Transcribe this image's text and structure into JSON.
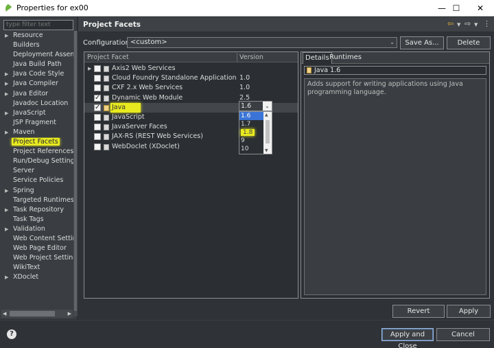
{
  "window": {
    "title": "Properties for ex00",
    "minimize": "—",
    "maximize": "☐",
    "close": "✕"
  },
  "sidebar": {
    "filter_placeholder": "type filter text",
    "items": [
      {
        "label": "Resource",
        "expandable": true
      },
      {
        "label": "Builders",
        "expandable": false
      },
      {
        "label": "Deployment Assembly",
        "expandable": false
      },
      {
        "label": "Java Build Path",
        "expandable": false
      },
      {
        "label": "Java Code Style",
        "expandable": true
      },
      {
        "label": "Java Compiler",
        "expandable": true
      },
      {
        "label": "Java Editor",
        "expandable": true
      },
      {
        "label": "Javadoc Location",
        "expandable": false
      },
      {
        "label": "JavaScript",
        "expandable": true
      },
      {
        "label": "JSP Fragment",
        "expandable": false
      },
      {
        "label": "Maven",
        "expandable": true
      },
      {
        "label": "Project Facets",
        "expandable": false,
        "selected": true
      },
      {
        "label": "Project References",
        "expandable": false
      },
      {
        "label": "Run/Debug Settings",
        "expandable": false
      },
      {
        "label": "Server",
        "expandable": false
      },
      {
        "label": "Service Policies",
        "expandable": false
      },
      {
        "label": "Spring",
        "expandable": true
      },
      {
        "label": "Targeted Runtimes",
        "expandable": false
      },
      {
        "label": "Task Repository",
        "expandable": true
      },
      {
        "label": "Task Tags",
        "expandable": false
      },
      {
        "label": "Validation",
        "expandable": true
      },
      {
        "label": "Web Content Settings",
        "expandable": false
      },
      {
        "label": "Web Page Editor",
        "expandable": false
      },
      {
        "label": "Web Project Settings",
        "expandable": false
      },
      {
        "label": "WikiText",
        "expandable": false
      },
      {
        "label": "XDoclet",
        "expandable": true
      }
    ]
  },
  "main": {
    "title": "Project Facets",
    "configuration_label": "Configuration:",
    "configuration_value": "<custom>",
    "save_as": "Save As...",
    "delete": "Delete",
    "columns": {
      "facet": "Project Facet",
      "version": "Version"
    },
    "facets": [
      {
        "label": "Axis2 Web Services",
        "version": "",
        "checked": false,
        "expander": true
      },
      {
        "label": "Cloud Foundry Standalone Application",
        "version": "1.0",
        "checked": false
      },
      {
        "label": "CXF 2.x Web Services",
        "version": "1.0",
        "checked": false
      },
      {
        "label": "Dynamic Web Module",
        "version": "2.5",
        "checked": true
      },
      {
        "label": "Java",
        "version": "1.6",
        "checked": true,
        "selected": true
      },
      {
        "label": "JavaScript",
        "version": "",
        "checked": false
      },
      {
        "label": "JavaServer Faces",
        "version": "",
        "checked": false
      },
      {
        "label": "JAX-RS (REST Web Services)",
        "version": "",
        "checked": false
      },
      {
        "label": "WebDoclet (XDoclet)",
        "version": "",
        "checked": false
      }
    ],
    "version_dropdown": {
      "current": "1.6",
      "options": [
        "1.6",
        "1.7",
        "1.8",
        "9",
        "10"
      ],
      "active_index": 0,
      "highlight_index": 2
    },
    "details_tab": "Details",
    "runtimes_tab": "Runtimes",
    "selected_facet": "Java 1.6",
    "description": "Adds support for writing applications using Java programming language.",
    "revert": "Revert",
    "apply": "Apply"
  },
  "footer": {
    "help": "?",
    "apply_close": "Apply and Close",
    "cancel": "Cancel"
  }
}
